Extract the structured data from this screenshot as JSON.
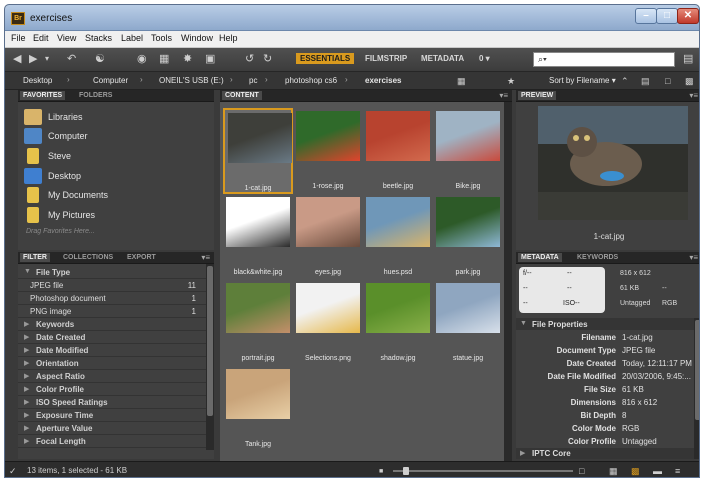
{
  "window": {
    "title": "exercises",
    "app_badge": "Br"
  },
  "menu": [
    "File",
    "Edit",
    "View",
    "Stacks",
    "Label",
    "Tools",
    "Window",
    "Help"
  ],
  "workspaces": {
    "active": "ESSENTIALS",
    "others": [
      "FILMSTRIP",
      "METADATA"
    ],
    "more": "0 ▾"
  },
  "search": {
    "value": "⌕▾"
  },
  "path": {
    "items": [
      "Desktop",
      "Computer",
      "ONEIL'S USB (E:)",
      "pc",
      "photoshop cs6"
    ],
    "current": "exercises",
    "sort_label": "Sort by Filename ▾"
  },
  "favorites": {
    "tabs": [
      "FAVORITES",
      "FOLDERS"
    ],
    "items": [
      {
        "label": "Libraries",
        "color": "#d9b46a"
      },
      {
        "label": "Computer",
        "color": "#4f86c6"
      },
      {
        "label": "Steve",
        "color": "#e6c24a"
      },
      {
        "label": "Desktop",
        "color": "#3f7fd0"
      },
      {
        "label": "My Documents",
        "color": "#e6c24a"
      },
      {
        "label": "My Pictures",
        "color": "#e6c24a"
      }
    ],
    "drag_hint": "Drag Favorites Here..."
  },
  "filter": {
    "tabs": [
      "FILTER",
      "COLLECTIONS",
      "EXPORT"
    ],
    "file_type_header": "File Type",
    "file_types": [
      {
        "label": "JPEG file",
        "count": "11"
      },
      {
        "label": "Photoshop document",
        "count": "1"
      },
      {
        "label": "PNG image",
        "count": "1"
      }
    ],
    "sections": [
      "Keywords",
      "Date Created",
      "Date Modified",
      "Orientation",
      "Aspect Ratio",
      "Color Profile",
      "ISO Speed Ratings",
      "Exposure Time",
      "Aperture Value",
      "Focal Length"
    ]
  },
  "content": {
    "tab": "CONTENT",
    "thumbs": [
      {
        "name": "1-cat.jpg",
        "c1": "#3e3f3a",
        "c2": "#6a7a86",
        "selected": true
      },
      {
        "name": "1-rose.jpg",
        "c1": "#2f6a2a",
        "c2": "#e0442d"
      },
      {
        "name": "beetle.jpg",
        "c1": "#b8432f",
        "c2": "#d26a4e"
      },
      {
        "name": "Bike.jpg",
        "c1": "#9fb3c4",
        "c2": "#c94a3c"
      },
      {
        "name": "black&white.jpg",
        "c1": "#ffffff",
        "c2": "#2a2a2a"
      },
      {
        "name": "eyes.jpg",
        "c1": "#c99a86",
        "c2": "#6a4b3c"
      },
      {
        "name": "hues.psd",
        "c1": "#6f97b8",
        "c2": "#d9b46a"
      },
      {
        "name": "park.jpg",
        "c1": "#2d5a28",
        "c2": "#8fb8d6"
      },
      {
        "name": "portrait.jpg",
        "c1": "#5e7f3a",
        "c2": "#c48f6a"
      },
      {
        "name": "Selections.png",
        "c1": "#f2f2f2",
        "c2": "#e6b84a"
      },
      {
        "name": "shadow.jpg",
        "c1": "#5a8f2a",
        "c2": "#8ab04a"
      },
      {
        "name": "statue.jpg",
        "c1": "#8fa6c0",
        "c2": "#d8e0ea"
      },
      {
        "name": "Tank.jpg",
        "c1": "#c9a47a",
        "c2": "#e8cfa6"
      }
    ]
  },
  "preview": {
    "tab": "PREVIEW",
    "caption": "1-cat.jpg"
  },
  "metadata": {
    "tabs": [
      "METADATA",
      "KEYWORDS"
    ],
    "camera": {
      "aperture": "f/--",
      "shutter": "--",
      "r2a": "--",
      "r2b": "--",
      "r3a": "--",
      "iso": "ISO--"
    },
    "summary": {
      "dims": "816 x 612",
      "size": "61 KB",
      "size_extra": "--",
      "profile": "Untagged",
      "mode": "RGB"
    },
    "section": "File Properties",
    "rows": [
      {
        "k": "Filename",
        "v": "1-cat.jpg"
      },
      {
        "k": "Document Type",
        "v": "JPEG file"
      },
      {
        "k": "Date Created",
        "v": "Today, 12:11:17 PM"
      },
      {
        "k": "Date File Modified",
        "v": "20/03/2006, 9:45:..."
      },
      {
        "k": "File Size",
        "v": "61 KB"
      },
      {
        "k": "Dimensions",
        "v": "816 x 612"
      },
      {
        "k": "Bit Depth",
        "v": "8"
      },
      {
        "k": "Color Mode",
        "v": "RGB"
      },
      {
        "k": "Color Profile",
        "v": "Untagged"
      }
    ],
    "next_section": "IPTC Core"
  },
  "status": {
    "text": "13 items, 1 selected - 61 KB"
  }
}
